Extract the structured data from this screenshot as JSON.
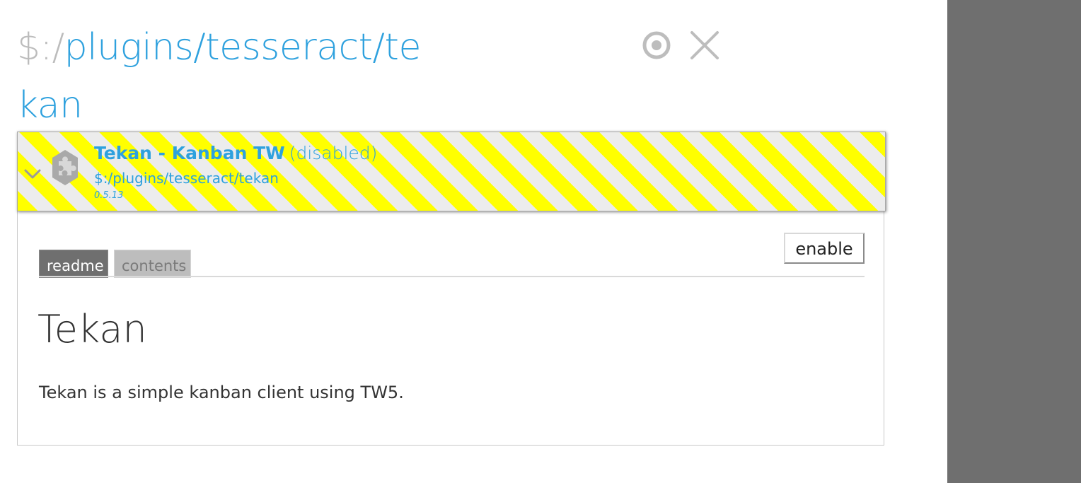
{
  "tiddler": {
    "title_prefix": "$:/",
    "title_rest": "plugins/tesseract/tekan",
    "controls": {
      "target_icon": "target-icon",
      "close_icon": "close-icon"
    }
  },
  "plugin": {
    "name": "Tekan - Kanban TW",
    "status": "(disabled)",
    "path": "$:/plugins/tesseract/tekan",
    "version": "0.5.13",
    "icon": "puzzle-piece-icon",
    "stripe_colors": [
      "#ffff00",
      "#ececec"
    ]
  },
  "actions": {
    "enable_label": "enable"
  },
  "tabs": [
    {
      "label": "readme",
      "active": true
    },
    {
      "label": "contents",
      "active": false
    }
  ],
  "readme": {
    "heading": "Tekan",
    "text": "Tekan is a simple kanban client using TW5."
  },
  "colors": {
    "accent": "#2ea1de",
    "sidebar": "#6f6f6f",
    "muted": "#bcbcbc"
  }
}
